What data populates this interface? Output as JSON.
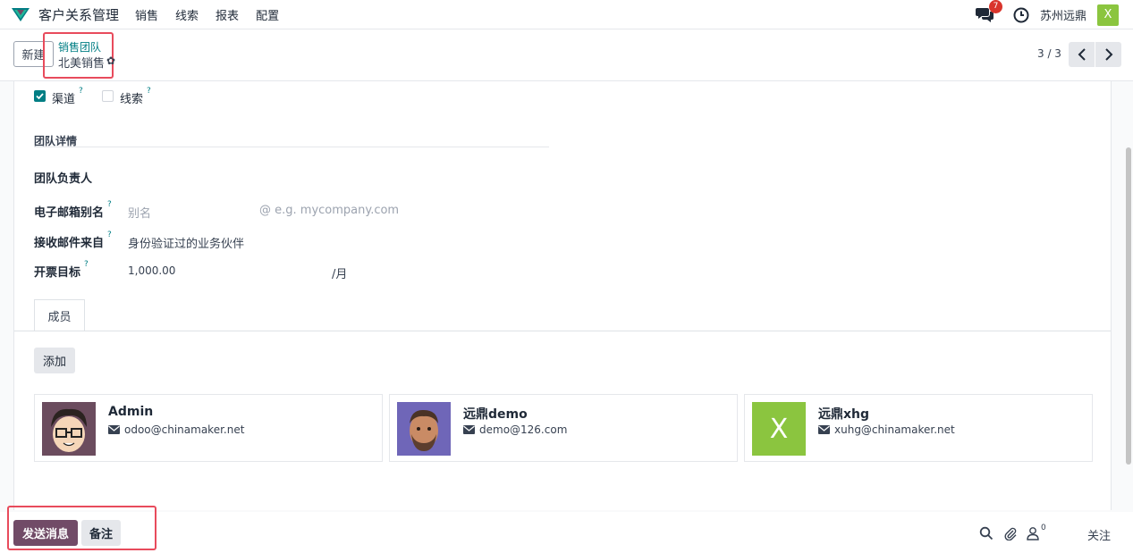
{
  "nav": {
    "app_title": "客户关系管理",
    "menu": [
      "销售",
      "线索",
      "报表",
      "配置"
    ],
    "chat_badge": "7",
    "company": "苏州远鼎",
    "user_initial": "X"
  },
  "control": {
    "new_label": "新建",
    "breadcrumb_parent": "销售团队",
    "breadcrumb_current": "北美销售",
    "pager": "3 / 3"
  },
  "form": {
    "channel_label": "渠道",
    "channel_checked": true,
    "leads_label": "线索",
    "leads_checked": false,
    "help_mark": "?",
    "section_title": "团队详情",
    "leader_label": "团队负责人",
    "email_alias_label": "电子邮箱别名",
    "email_alias_placeholder": "别名",
    "email_domain_placeholder": "@ e.g. mycompany.com",
    "accept_from_label": "接收邮件来自",
    "accept_from_value": "身份验证过的业务伙伴",
    "invoice_target_label": "开票目标",
    "invoice_target_value": "1,000.00",
    "invoice_target_unit": "/月"
  },
  "members": {
    "tab_label": "成员",
    "add_label": "添加",
    "cards": [
      {
        "name": "Admin",
        "email": "odoo@chinamaker.net"
      },
      {
        "name": "远鼎demo",
        "email": "demo@126.com"
      },
      {
        "name": "远鼎xhg",
        "email": "xuhg@chinamaker.net",
        "initial": "X"
      }
    ]
  },
  "chatter": {
    "send_label": "发送消息",
    "note_label": "备注",
    "follower_count": "0",
    "follow_label": "关注"
  },
  "colors": {
    "brand": "#714b67",
    "teal": "#017e84",
    "highlight": "#e84b5c",
    "avatar_green": "#8bc53f"
  }
}
